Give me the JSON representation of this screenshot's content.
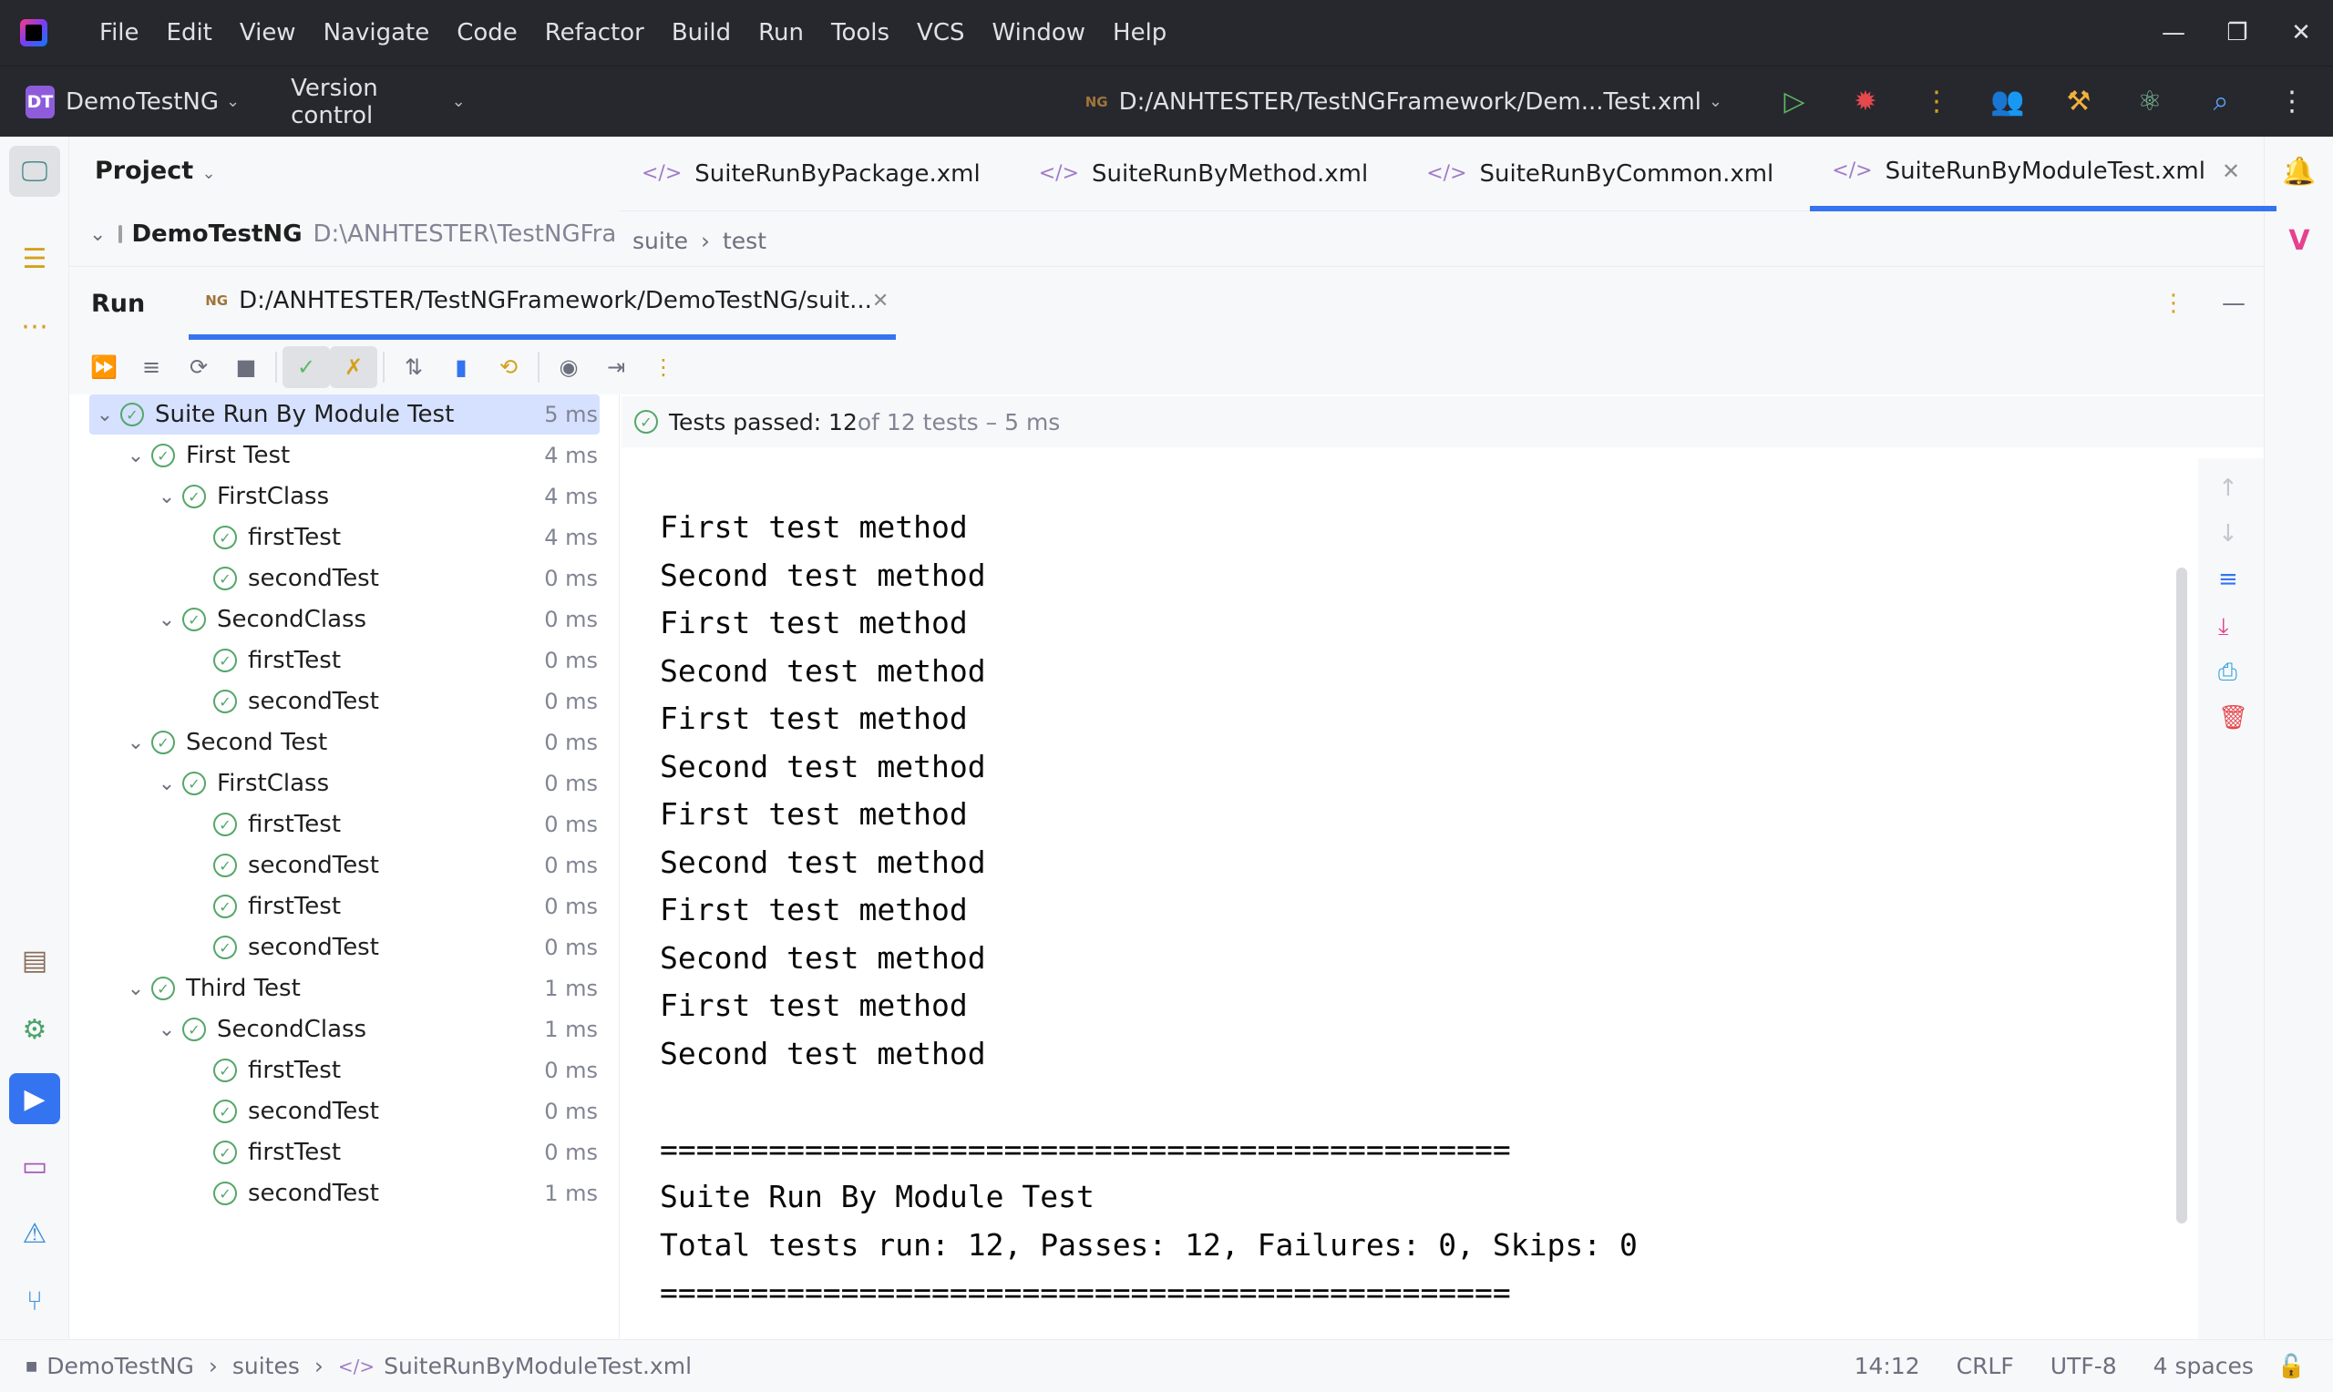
{
  "menu": [
    "File",
    "Edit",
    "View",
    "Navigate",
    "Code",
    "Refactor",
    "Build",
    "Run",
    "Tools",
    "VCS",
    "Window",
    "Help"
  ],
  "project": {
    "badge": "DT",
    "name": "DemoTestNG",
    "version_control": "Version control",
    "run_config": "D:/ANHTESTER/TestNGFramework/Dem...Test.xml"
  },
  "project_panel": {
    "title": "Project",
    "root_name": "DemoTestNG",
    "root_path": "D:\\ANHTESTER\\TestNGFramework"
  },
  "editor": {
    "tabs": [
      {
        "label": "SuiteRunByPackage.xml"
      },
      {
        "label": "SuiteRunByMethod.xml"
      },
      {
        "label": "SuiteRunByCommon.xml"
      },
      {
        "label": "SuiteRunByModuleTest.xml"
      }
    ],
    "breadcrumb": [
      "suite",
      "test"
    ]
  },
  "run": {
    "label": "Run",
    "tab_label": "D:/ANHTESTER/TestNGFramework/DemoTestNG/suit...",
    "status_prefix": "Tests passed: 12",
    "status_suffix": " of 12 tests – 5 ms",
    "tree": [
      {
        "label": "Suite Run By Module Test",
        "dur": "5 ms"
      },
      {
        "label": "First Test",
        "dur": "4 ms"
      },
      {
        "label": "FirstClass",
        "dur": "4 ms"
      },
      {
        "label": "firstTest",
        "dur": "4 ms"
      },
      {
        "label": "secondTest",
        "dur": "0 ms"
      },
      {
        "label": "SecondClass",
        "dur": "0 ms"
      },
      {
        "label": "firstTest",
        "dur": "0 ms"
      },
      {
        "label": "secondTest",
        "dur": "0 ms"
      },
      {
        "label": "Second Test",
        "dur": "0 ms"
      },
      {
        "label": "FirstClass",
        "dur": "0 ms"
      },
      {
        "label": "firstTest",
        "dur": "0 ms"
      },
      {
        "label": "secondTest",
        "dur": "0 ms"
      },
      {
        "label": "firstTest",
        "dur": "0 ms"
      },
      {
        "label": "secondTest",
        "dur": "0 ms"
      },
      {
        "label": "Third Test",
        "dur": "1 ms"
      },
      {
        "label": "SecondClass",
        "dur": "1 ms"
      },
      {
        "label": "firstTest",
        "dur": "0 ms"
      },
      {
        "label": "secondTest",
        "dur": "0 ms"
      },
      {
        "label": "firstTest",
        "dur": "0 ms"
      },
      {
        "label": "secondTest",
        "dur": "1 ms"
      }
    ],
    "console": [
      "First test method",
      "Second test method",
      "First test method",
      "Second test method",
      "First test method",
      "Second test method",
      "First test method",
      "Second test method",
      "First test method",
      "Second test method",
      "First test method",
      "Second test method",
      "",
      "===============================================",
      "Suite Run By Module Test",
      "Total tests run: 12, Passes: 12, Failures: 0, Skips: 0",
      "==============================================="
    ]
  },
  "statusbar": {
    "crumbs": [
      "DemoTestNG",
      "suites",
      "SuiteRunByModuleTest.xml"
    ],
    "position": "14:12",
    "line_sep": "CRLF",
    "encoding": "UTF-8",
    "indent": "4 spaces"
  },
  "colors": {
    "accent": "#3574f0",
    "pass": "#55a76a",
    "titlebar": "#27282e"
  }
}
